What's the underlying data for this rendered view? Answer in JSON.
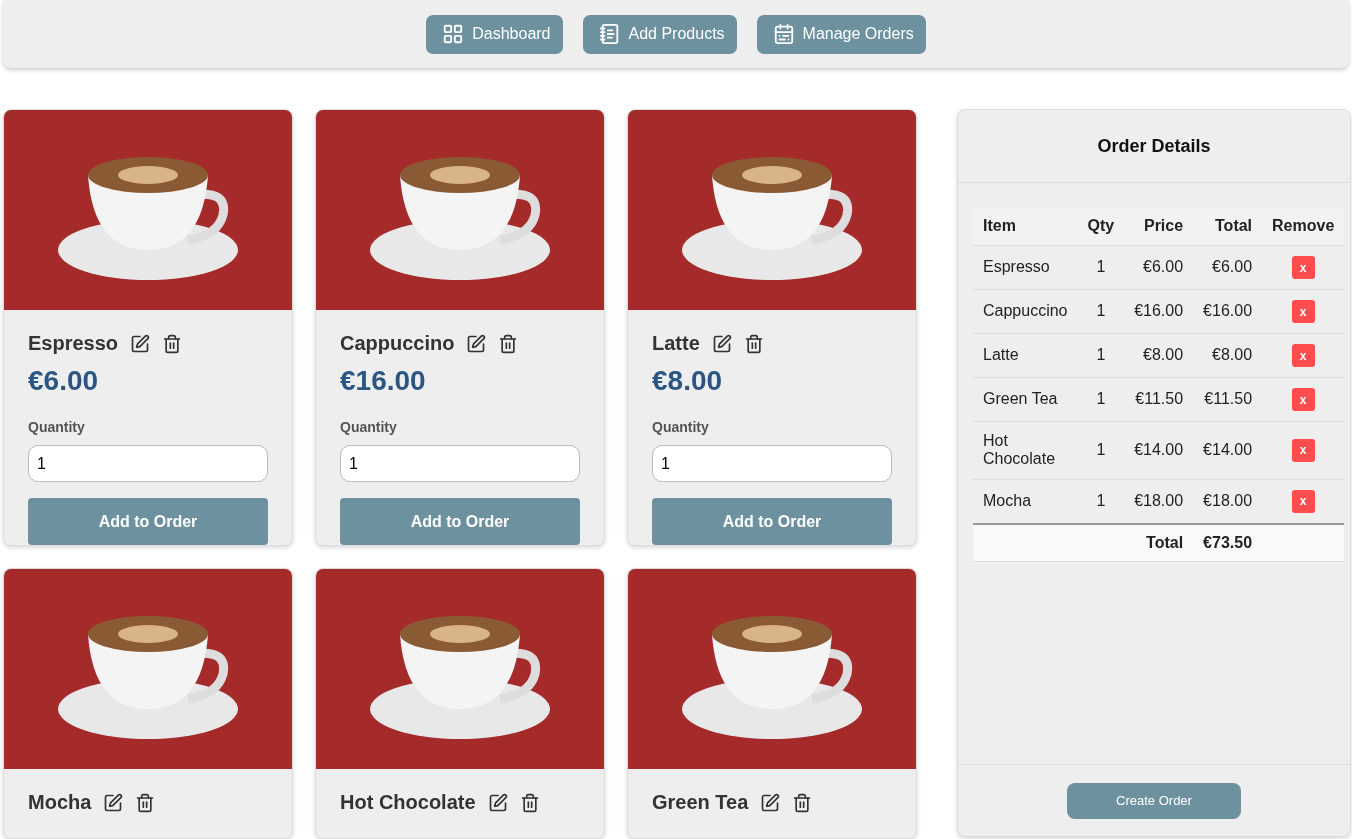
{
  "nav": [
    {
      "label": "Dashboard"
    },
    {
      "label": "Add Products"
    },
    {
      "label": "Manage Orders"
    }
  ],
  "products": [
    {
      "name": "Espresso",
      "price": "€6.00",
      "quantity_label": "Quantity",
      "quantity": "1",
      "button": "Add to Order"
    },
    {
      "name": "Cappuccino",
      "price": "€16.00",
      "quantity_label": "Quantity",
      "quantity": "1",
      "button": "Add to Order"
    },
    {
      "name": "Latte",
      "price": "€8.00",
      "quantity_label": "Quantity",
      "quantity": "1",
      "button": "Add to Order"
    },
    {
      "name": "Mocha"
    },
    {
      "name": "Hot Chocolate"
    },
    {
      "name": "Green Tea"
    }
  ],
  "order": {
    "title": "Order Details",
    "columns": [
      "Item",
      "Qty",
      "Price",
      "Total",
      "Remove"
    ],
    "rows": [
      {
        "item": "Espresso",
        "qty": "1",
        "price": "€6.00",
        "total": "€6.00",
        "remove": "x"
      },
      {
        "item": "Cappuccino",
        "qty": "1",
        "price": "€16.00",
        "total": "€16.00",
        "remove": "x"
      },
      {
        "item": "Latte",
        "qty": "1",
        "price": "€8.00",
        "total": "€8.00",
        "remove": "x"
      },
      {
        "item": "Green Tea",
        "qty": "1",
        "price": "€11.50",
        "total": "€11.50",
        "remove": "x"
      },
      {
        "item": "Hot Chocolate",
        "qty": "1",
        "price": "€14.00",
        "total": "€14.00",
        "remove": "x"
      },
      {
        "item": "Mocha",
        "qty": "1",
        "price": "€18.00",
        "total": "€18.00",
        "remove": "x"
      }
    ],
    "total_label": "Total",
    "total": "€73.50",
    "button": "Create Order"
  }
}
